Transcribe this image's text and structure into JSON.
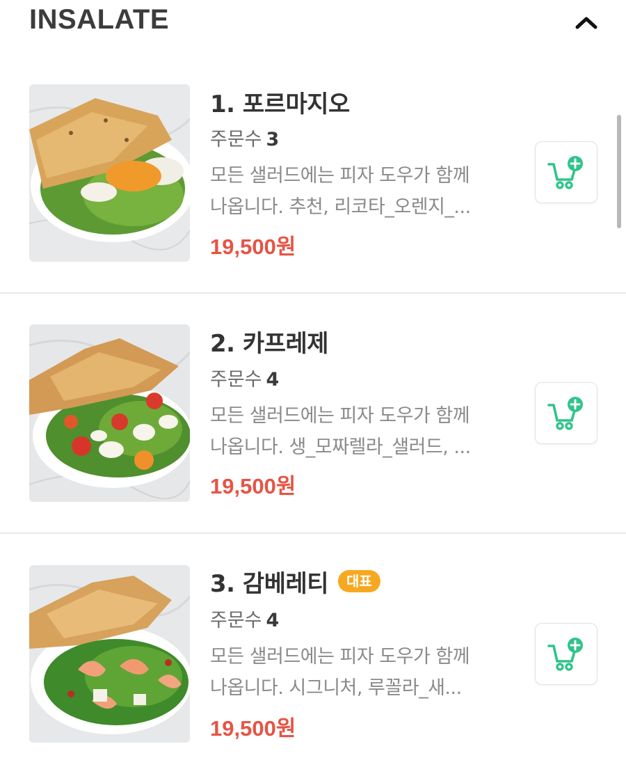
{
  "section": {
    "title": "INSALATE",
    "collapse_icon": "chevron-up-icon"
  },
  "items": [
    {
      "name": "1. 포르마지오",
      "order_label": "주문수",
      "order_count": "3",
      "desc_line1": "모든 샐러드에는 피자 도우가 함께",
      "desc_line2": "나옵니다. 추천, 리코타_오렌지_...",
      "price": "19,500원",
      "badge": "",
      "cart_icon": "add-to-cart-icon"
    },
    {
      "name": "2. 카프레제",
      "order_label": "주문수",
      "order_count": "4",
      "desc_line1": "모든 샐러드에는 피자 도우가 함께",
      "desc_line2": "나옵니다. 생_모짜렐라_샐러드, ...",
      "price": "19,500원",
      "badge": "",
      "cart_icon": "add-to-cart-icon"
    },
    {
      "name": "3. 감베레티",
      "order_label": "주문수",
      "order_count": "4",
      "desc_line1": "모든 샐러드에는 피자 도우가 함께",
      "desc_line2": "나옵니다. 시그니처, 루꼴라_새...",
      "price": "19,500원",
      "badge": "대표",
      "cart_icon": "add-to-cart-icon"
    }
  ],
  "colors": {
    "price": "#e65445",
    "badge": "#f7a821",
    "cart_accent": "#2ec48a"
  }
}
